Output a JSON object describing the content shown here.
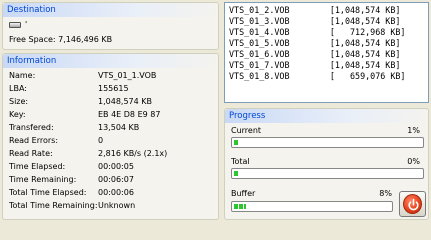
{
  "destination": {
    "title": "Destination",
    "drive_label": "'",
    "free_space_label": "Free Space:",
    "free_space_value": "7,146,496 KB",
    "drive_icon": "drive-icon"
  },
  "information": {
    "title": "Information",
    "rows": [
      {
        "label": "Name:",
        "value": "VTS_01_1.VOB"
      },
      {
        "label": "LBA:",
        "value": "155615"
      },
      {
        "label": "Size:",
        "value": "1,048,574 KB"
      },
      {
        "label": "Key:",
        "value": "EB 4E D8 E9 87"
      },
      {
        "label": "Transfered:",
        "value": "13,504 KB"
      },
      {
        "label": "Read Errors:",
        "value": "0"
      },
      {
        "label": "Read Rate:",
        "value": "2,816 KB/s (2.1x)"
      },
      {
        "label": "Time Elapsed:",
        "value": "00:00:05"
      },
      {
        "label": "Time Remaining:",
        "value": "00:06:07"
      },
      {
        "label": "Total Time Elapsed:",
        "value": "00:00:06"
      },
      {
        "label": "Total Time Remaining:",
        "value": "Unknown"
      }
    ]
  },
  "file_list": [
    "VTS_01_2.VOB        [1,048,574 KB]",
    "VTS_01_3.VOB        [1,048,574 KB]",
    "VTS_01_4.VOB        [   712,968 KB]",
    "VTS_01_5.VOB        [1,048,574 KB]",
    "VTS_01_6.VOB        [1,048,574 KB]",
    "VTS_01_7.VOB        [1,048,574 KB]",
    "VTS_01_8.VOB        [   659,076 KB]"
  ],
  "progress": {
    "title": "Progress",
    "current": {
      "label": "Current",
      "percent_text": "1%",
      "fraction": 0.01
    },
    "total": {
      "label": "Total",
      "percent_text": "0%",
      "fraction": 0.0
    },
    "buffer": {
      "label": "Buffer",
      "percent_text": "8%",
      "fraction": 0.08
    },
    "stop_icon": "power-stop-icon"
  },
  "colors": {
    "title_text": "#0046d5",
    "progress_fill": "#2fc52f",
    "stop_button": "#e8411c"
  }
}
